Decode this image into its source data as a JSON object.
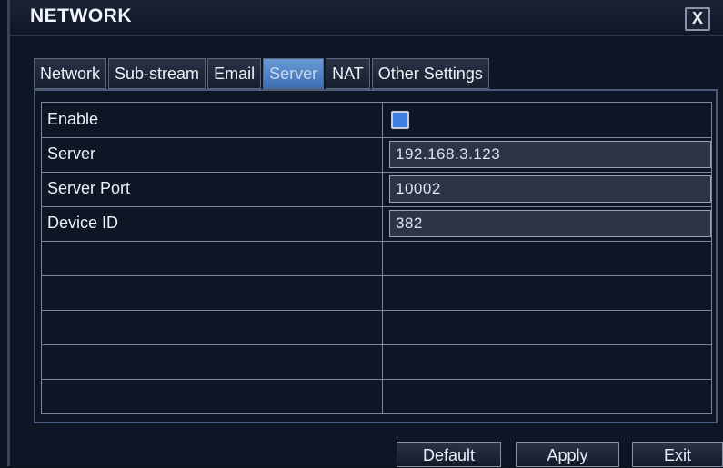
{
  "window": {
    "title": "NETWORK",
    "close_label": "X"
  },
  "tabs": [
    {
      "label": "Network",
      "active": false
    },
    {
      "label": "Sub-stream",
      "active": false
    },
    {
      "label": "Email",
      "active": false
    },
    {
      "label": "Server",
      "active": true
    },
    {
      "label": "NAT",
      "active": false
    },
    {
      "label": "Other Settings",
      "active": false
    }
  ],
  "form": {
    "enable": {
      "label": "Enable",
      "checked": true
    },
    "server": {
      "label": "Server",
      "value": "192.168.3.123"
    },
    "server_port": {
      "label": "Server Port",
      "value": "10002"
    },
    "device_id": {
      "label": "Device ID",
      "value": "382"
    }
  },
  "footer": {
    "default_label": "Default",
    "apply_label": "Apply",
    "exit_label": "Exit"
  },
  "colors": {
    "accent": "#3d7fe0",
    "active_tab": "#5a8bd0",
    "background": "#0e1626"
  }
}
